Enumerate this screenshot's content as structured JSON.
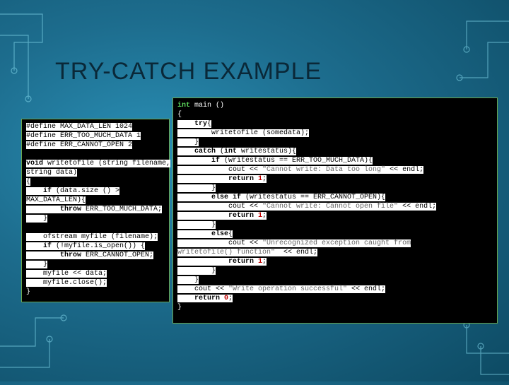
{
  "slide": {
    "title": "TRY-CATCH EXAMPLE"
  },
  "code_left": {
    "l1": "#define MAX_DATA_LEN 1024",
    "l2": "#define ERR_TOO_MUCH_DATA 1",
    "l3": "#define ERR_CANNOT_OPEN 2",
    "l4": "",
    "l5a": "void",
    "l5b": " writetofile (string filename,",
    "l6": "string data)",
    "l7": "{",
    "l8a": "    if",
    "l8b": " (data.size () >",
    "l9": "MAX_DATA_LEN){",
    "l10a": "        throw",
    "l10b": " ERR_TOO_MUCH_DATA;",
    "l11": "    }",
    "l12": "",
    "l13": "    ofstream myfile (filename);",
    "l14a": "    if",
    "l14b": " (!myfile.is_open()) {",
    "l15a": "        throw",
    "l15b": " ERR_CANNOT_OPEN;",
    "l16": "    }",
    "l17": "    myfile << data;",
    "l18": "    myfile.close();",
    "l19": "}"
  },
  "code_right": {
    "r1a": "int",
    "r1b": " main ()",
    "r2": "{",
    "r3a": "    try",
    "r3b": "{",
    "r4": "        writetofile (somedata);",
    "r5": "    }",
    "r6a": "    catch",
    "r6b": " (",
    "r6c": "int",
    "r6d": " writestatus){",
    "r7a": "        if",
    "r7b": " (writestatus == ERR_TOO_MUCH_DATA){",
    "r8a": "            cout << ",
    "r8b": "\"Cannot write: Data too long\"",
    "r8c": " << endl;",
    "r9a": "            return",
    "r9b": " 1",
    "r9c": ";",
    "r10": "        }",
    "r11a": "        else if",
    "r11b": " (writestatus == ERR_CANNOT_OPEN){",
    "r12a": "            cout << ",
    "r12b": "\"Cannot write: Cannot open file\"",
    "r12c": " << endl;",
    "r13a": "            return",
    "r13b": " 1",
    "r13c": ";",
    "r14": "        }",
    "r15a": "        else",
    "r15b": "{",
    "r16a": "            cout << ",
    "r16b": "\"Unrecognized exception caught from",
    "r17a": "writetofile() function\"",
    "r17b": "  << endl;",
    "r18a": "            return",
    "r18b": " 1",
    "r18c": ";",
    "r19": "        }",
    "r20": "    }",
    "r21a": "    cout << ",
    "r21b": "\"Write operation successful\"",
    "r21c": " << endl;",
    "r22a": "    return",
    "r22b": " 0",
    "r22c": ";",
    "r23": "}"
  }
}
